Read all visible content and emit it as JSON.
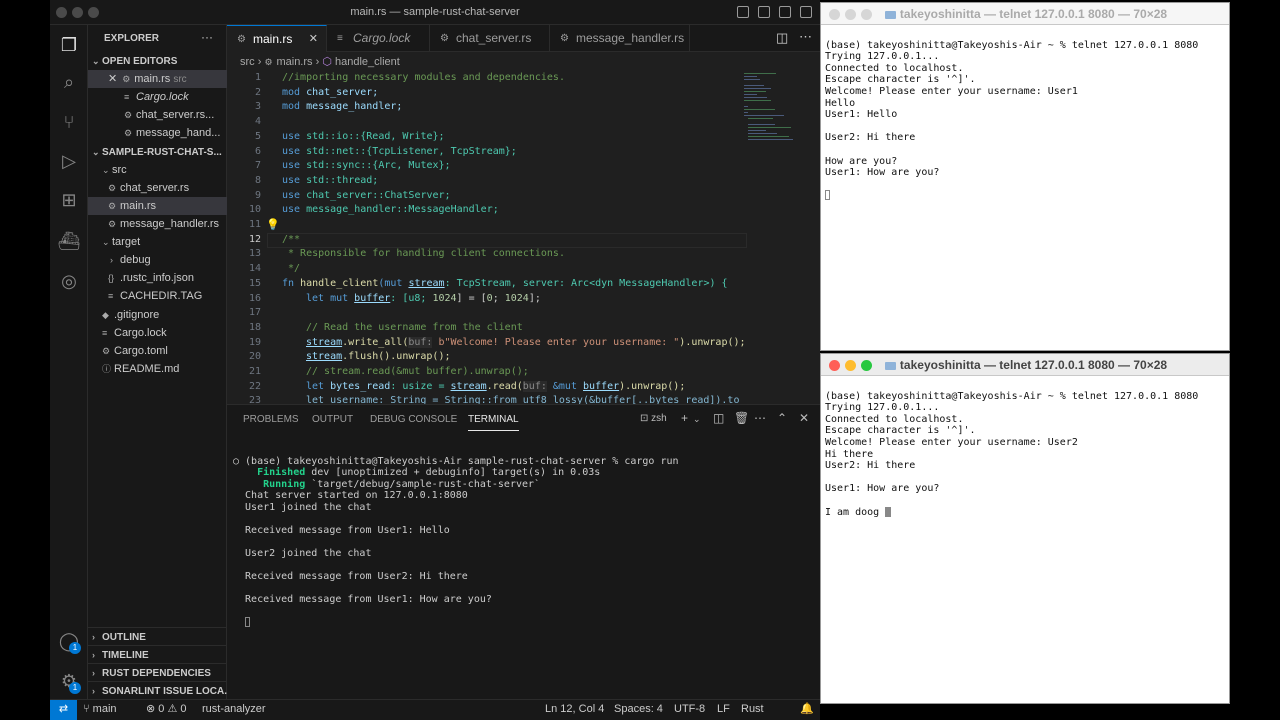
{
  "vscode": {
    "window_title": "main.rs — sample-rust-chat-server",
    "explorer": {
      "header": "EXPLORER",
      "more": "···",
      "open_editors_label": "OPEN EDITORS",
      "open_editors": [
        {
          "name": "main.rs",
          "desc": "src",
          "close": "✕"
        },
        {
          "name": "Cargo.lock"
        },
        {
          "name": "chat_server.rs..."
        },
        {
          "name": "message_hand..."
        }
      ],
      "project_label": "SAMPLE-RUST-CHAT-S...",
      "tree": {
        "src": "src",
        "chat_server": "chat_server.rs",
        "main": "main.rs",
        "message_handler": "message_handler.rs",
        "target": "target",
        "debug": "debug",
        "rustc_info": ".rustc_info.json",
        "cachedir": "CACHEDIR.TAG",
        "gitignore": ".gitignore",
        "cargo_lock": "Cargo.lock",
        "cargo_toml": "Cargo.toml",
        "readme": "README.md"
      },
      "bottom_sections": {
        "outline": "OUTLINE",
        "timeline": "TIMELINE",
        "rust_deps": "RUST DEPENDENCIES",
        "sonarlint": "SONARLINT ISSUE LOCA..."
      }
    },
    "tabs": [
      "main.rs",
      "Cargo.lock",
      "chat_server.rs",
      "message_handler.rs"
    ],
    "tab_close": "✕",
    "breadcrumb": {
      "folder": "src",
      "file": "main.rs",
      "symbol": "handle_client"
    },
    "line_numbers": [
      "1",
      "2",
      "3",
      "4",
      "5",
      "6",
      "7",
      "8",
      "9",
      "10",
      "11",
      "12",
      "13",
      "14",
      "15",
      "16",
      "17",
      "18",
      "19",
      "20",
      "21",
      "22",
      "23"
    ],
    "code": {
      "l1": "//importing necessary modules and dependencies.",
      "l2a": "mod",
      "l2b": " chat_server;",
      "l3a": "mod",
      "l3b": " message_handler;",
      "l5a": "use",
      "l5b": " std::io::{Read, Write};",
      "l6a": "use",
      "l6b": " std::net::{TcpListener, TcpStream};",
      "l7a": "use",
      "l7b": " std::sync::{Arc, Mutex};",
      "l8a": "use",
      "l8b": " std::thread;",
      "l9a": "use",
      "l9b": " chat_server::ChatServer;",
      "l10a": "use",
      "l10b": " message_handler::MessageHandler;",
      "l12": "/**",
      "l13": " * Responsible for handling client connections.",
      "l14": " */",
      "l15a": "fn",
      "l15b": " handle_client",
      "l15c": "(mut ",
      "l15d": "stream",
      "l15e": ": TcpStream, server: Arc<dyn MessageHandler>) {",
      "l16a": "let mut ",
      "l16b": "buffer",
      "l16c": ": [u8; ",
      "l16d": "1024",
      "l16e": "] = [",
      "l16f": "0",
      "l16g": "; ",
      "l16h": "1024",
      "l16i": "];",
      "l18": "// Read the username from the client",
      "l19a": "stream",
      "l19b": ".write_all(",
      "l19c": "buf:",
      "l19d": " b\"Welcome! Please enter your username: \"",
      "l19e": ").unwrap();",
      "l20a": "stream",
      "l20b": ".flush().unwrap();",
      "l21": "// stream.read(&mut buffer).unwrap();",
      "l22a": "let ",
      "l22b": "bytes_read",
      "l22c": ": usize = ",
      "l22d": "stream",
      "l22e": ".read(",
      "l22f": "buf:",
      "l22g": " &mut ",
      "l22h": "buffer",
      "l22i": ").unwrap();",
      "l23": "let username: String = String::from_utf8_lossy(&buffer[..bytes_read]).to"
    },
    "panel": {
      "tabs": [
        "PROBLEMS",
        "OUTPUT",
        "DEBUG CONSOLE",
        "TERMINAL"
      ],
      "shell": "zsh",
      "terminal": {
        "l1": "○ (base) takeyoshinitta@Takeyoshis-Air sample-rust-chat-server % cargo run",
        "l2a": "    Finished",
        "l2b": " dev [unoptimized + debuginfo] target(s) in 0.03s",
        "l3a": "     Running",
        "l3b": " `target/debug/sample-rust-chat-server`",
        "l4": "  Chat server started on 127.0.0.1:8080",
        "l5": "  User1 joined the chat",
        "l7": "  Received message from User1: Hello",
        "l9": "  User2 joined the chat",
        "l11": "  Received message from User2: Hi there",
        "l13": "  Received message from User1: How are you?"
      }
    },
    "status": {
      "branch": "main",
      "problems": "⊗ 0 ⚠ 0",
      "analyzer": "rust-analyzer",
      "position": "Ln 12, Col 4",
      "spaces": "Spaces: 4",
      "encoding": "UTF-8",
      "eol": "LF",
      "language": "Rust",
      "badge": "1"
    }
  },
  "terminal_windows": [
    {
      "title": "takeyoshinitta — telnet 127.0.0.1 8080 — 70×28",
      "lines": [
        "(base) takeyoshinitta@Takeyoshis-Air ~ % telnet 127.0.0.1 8080",
        "Trying 127.0.0.1...",
        "Connected to localhost.",
        "Escape character is '^]'.",
        "Welcome! Please enter your username: User1",
        "Hello",
        "User1: Hello",
        "",
        "User2: Hi there",
        "",
        "How are you?",
        "User1: How are you?",
        ""
      ]
    },
    {
      "title": "takeyoshinitta — telnet 127.0.0.1 8080 — 70×28",
      "lines": [
        "(base) takeyoshinitta@Takeyoshis-Air ~ % telnet 127.0.0.1 8080",
        "Trying 127.0.0.1...",
        "Connected to localhost.",
        "Escape character is '^]'.",
        "Welcome! Please enter your username: User2",
        "Hi there",
        "User2: Hi there",
        "",
        "User1: How are you?",
        ""
      ],
      "typing": "I am doog "
    }
  ],
  "colors": {
    "accent": "#0078d4",
    "keyword": "#569cd6",
    "comment": "#6a9955",
    "type": "#4ec9b0",
    "function": "#dcdcaa",
    "string": "#ce9178",
    "variable": "#9cdcfe",
    "terminal_green": "#23d18b"
  }
}
